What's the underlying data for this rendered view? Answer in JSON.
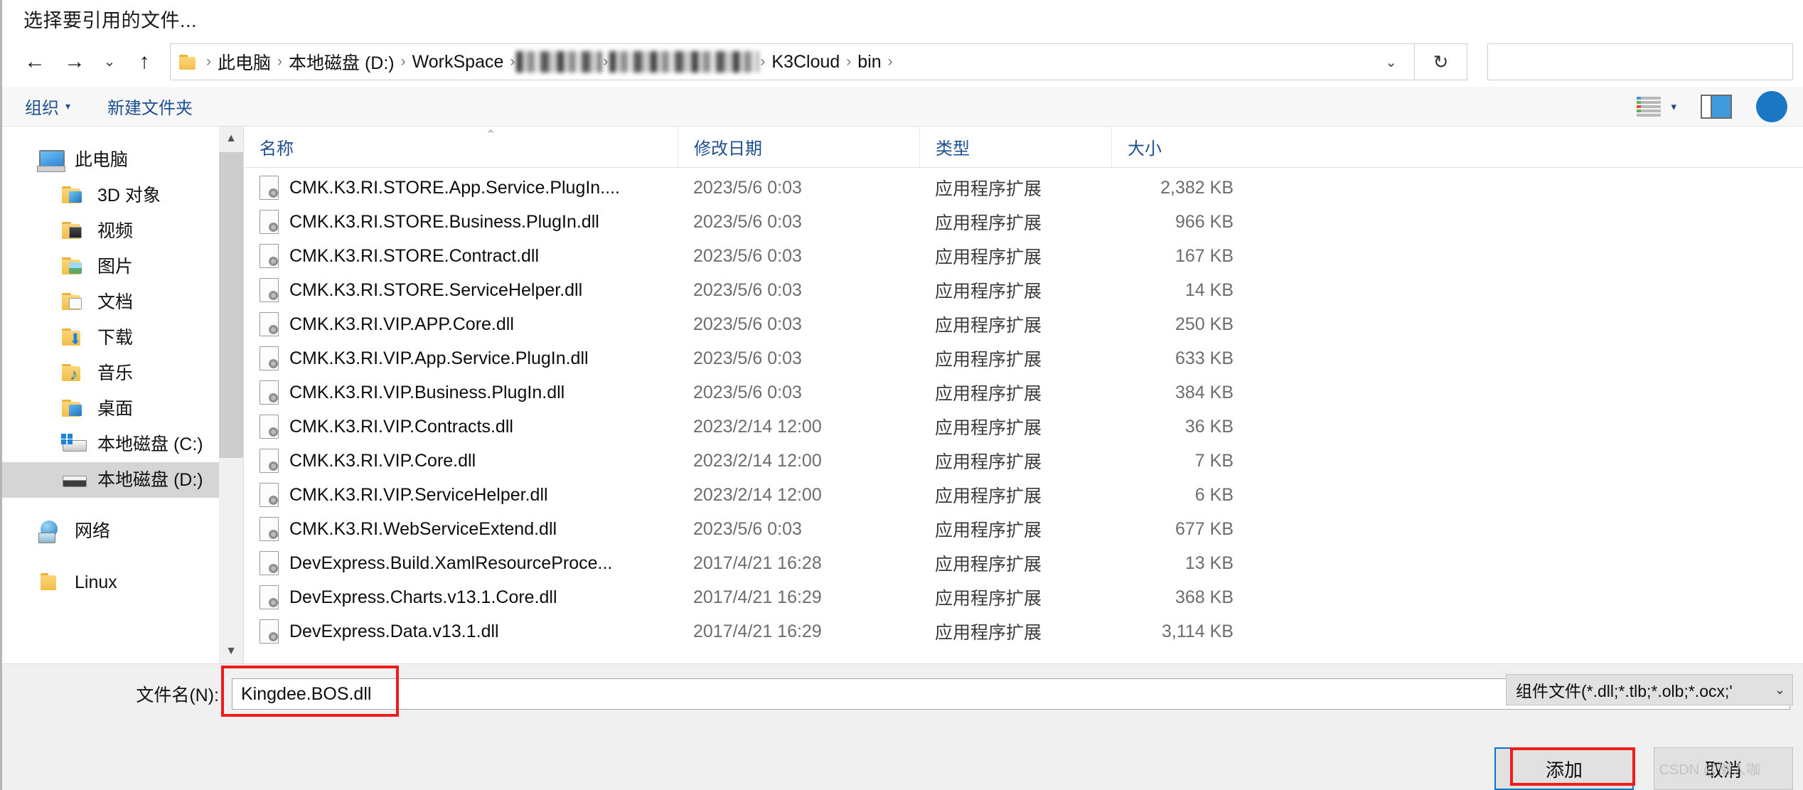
{
  "dialog": {
    "title": "选择要引用的文件..."
  },
  "nav": {
    "back_icon": "arrow-left-icon",
    "forward_icon": "arrow-right-icon",
    "recent_icon": "chevron-down-icon",
    "up_icon": "arrow-up-icon",
    "dropdown_icon": "chevron-down-icon",
    "refresh_icon": "refresh-icon",
    "breadcrumbs": [
      {
        "label": "此电脑",
        "redacted": false
      },
      {
        "label": "本地磁盘 (D:)",
        "redacted": false
      },
      {
        "label": "WorkSpace",
        "redacted": false
      },
      {
        "label": "",
        "redacted": true
      },
      {
        "label": "",
        "redacted": true
      },
      {
        "label": "K3Cloud",
        "redacted": false
      },
      {
        "label": "bin",
        "redacted": false
      }
    ]
  },
  "command_bar": {
    "organize_label": "组织",
    "new_folder_label": "新建文件夹",
    "view_icon": "list-view-icon",
    "preview_pane_icon": "preview-pane-icon",
    "help_icon": "help-icon"
  },
  "sidebar": {
    "items": [
      {
        "label": "此电脑",
        "icon": "computer-icon",
        "level": 1,
        "selected": false
      },
      {
        "label": "3D 对象",
        "icon": "folder-3d-icon",
        "level": 2,
        "selected": false
      },
      {
        "label": "视频",
        "icon": "folder-video-icon",
        "level": 2,
        "selected": false
      },
      {
        "label": "图片",
        "icon": "folder-pictures-icon",
        "level": 2,
        "selected": false
      },
      {
        "label": "文档",
        "icon": "folder-documents-icon",
        "level": 2,
        "selected": false
      },
      {
        "label": "下载",
        "icon": "folder-downloads-icon",
        "level": 2,
        "selected": false
      },
      {
        "label": "音乐",
        "icon": "folder-music-icon",
        "level": 2,
        "selected": false
      },
      {
        "label": "桌面",
        "icon": "folder-desktop-icon",
        "level": 2,
        "selected": false
      },
      {
        "label": "本地磁盘 (C:)",
        "icon": "drive-windows-icon",
        "level": 2,
        "selected": false
      },
      {
        "label": "本地磁盘 (D:)",
        "icon": "drive-icon",
        "level": 2,
        "selected": true
      },
      {
        "label": "网络",
        "icon": "network-icon",
        "level": 1,
        "selected": false
      },
      {
        "label": "Linux",
        "icon": "folder-icon",
        "level": 1,
        "selected": false
      }
    ],
    "scroll_up_icon": "scroll-up-icon",
    "scroll_down_icon": "scroll-down-icon"
  },
  "file_list": {
    "columns": [
      "名称",
      "修改日期",
      "类型",
      "大小"
    ],
    "sort_indicator": "sort-ascending-icon",
    "rows": [
      {
        "name": "CMK.K3.RI.STORE.App.Service.PlugIn....",
        "date": "2023/5/6 0:03",
        "type": "应用程序扩展",
        "size": "2,382 KB"
      },
      {
        "name": "CMK.K3.RI.STORE.Business.PlugIn.dll",
        "date": "2023/5/6 0:03",
        "type": "应用程序扩展",
        "size": "966 KB"
      },
      {
        "name": "CMK.K3.RI.STORE.Contract.dll",
        "date": "2023/5/6 0:03",
        "type": "应用程序扩展",
        "size": "167 KB"
      },
      {
        "name": "CMK.K3.RI.STORE.ServiceHelper.dll",
        "date": "2023/5/6 0:03",
        "type": "应用程序扩展",
        "size": "14 KB"
      },
      {
        "name": "CMK.K3.RI.VIP.APP.Core.dll",
        "date": "2023/5/6 0:03",
        "type": "应用程序扩展",
        "size": "250 KB"
      },
      {
        "name": "CMK.K3.RI.VIP.App.Service.PlugIn.dll",
        "date": "2023/5/6 0:03",
        "type": "应用程序扩展",
        "size": "633 KB"
      },
      {
        "name": "CMK.K3.RI.VIP.Business.PlugIn.dll",
        "date": "2023/5/6 0:03",
        "type": "应用程序扩展",
        "size": "384 KB"
      },
      {
        "name": "CMK.K3.RI.VIP.Contracts.dll",
        "date": "2023/2/14 12:00",
        "type": "应用程序扩展",
        "size": "36 KB"
      },
      {
        "name": "CMK.K3.RI.VIP.Core.dll",
        "date": "2023/2/14 12:00",
        "type": "应用程序扩展",
        "size": "7 KB"
      },
      {
        "name": "CMK.K3.RI.VIP.ServiceHelper.dll",
        "date": "2023/2/14 12:00",
        "type": "应用程序扩展",
        "size": "6 KB"
      },
      {
        "name": "CMK.K3.RI.WebServiceExtend.dll",
        "date": "2023/5/6 0:03",
        "type": "应用程序扩展",
        "size": "677 KB"
      },
      {
        "name": "DevExpress.Build.XamlResourceProce...",
        "date": "2017/4/21 16:28",
        "type": "应用程序扩展",
        "size": "13 KB"
      },
      {
        "name": "DevExpress.Charts.v13.1.Core.dll",
        "date": "2017/4/21 16:29",
        "type": "应用程序扩展",
        "size": "368 KB"
      },
      {
        "name": "DevExpress.Data.v13.1.dll",
        "date": "2017/4/21 16:29",
        "type": "应用程序扩展",
        "size": "3,114 KB"
      }
    ]
  },
  "footer": {
    "filename_label": "文件名(N):",
    "filename_value": "Kingdee.BOS.dll",
    "filename_dropdown_icon": "chevron-down-icon",
    "filter_value": "组件文件(*.dll;*.tlb;*.olb;*.ocx;'",
    "filter_dropdown_icon": "chevron-down-icon",
    "add_button": "添加",
    "cancel_button": "取消",
    "watermark": "CSDN @懒人咖",
    "annotation_color": "#f01c1c"
  }
}
